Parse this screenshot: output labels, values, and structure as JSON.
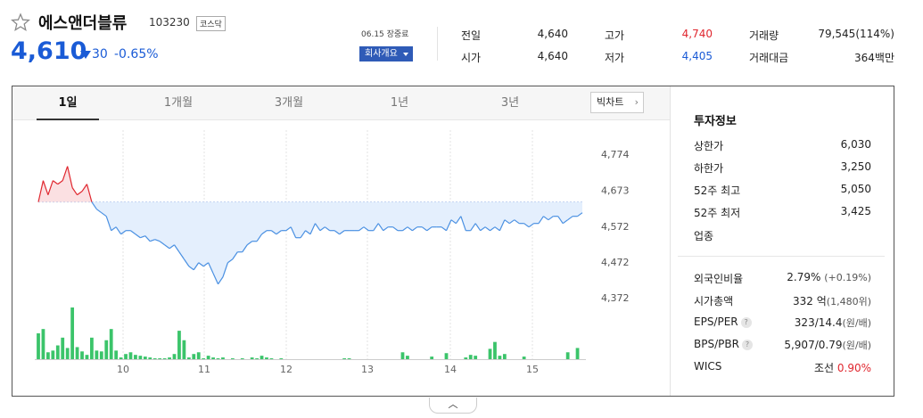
{
  "stock": {
    "name": "에스앤더블류",
    "code": "103230",
    "market_badge": "코스닥",
    "price": "4,610",
    "change": "30",
    "change_rate": "-0.65%",
    "as_of": "06.15 장중료",
    "company_button": "회사개요"
  },
  "quote": {
    "prev_close_label": "전일",
    "prev_close": "4,640",
    "open_label": "시가",
    "open": "4,640",
    "high_label": "고가",
    "high": "4,740",
    "low_label": "저가",
    "low": "4,405",
    "volume_label": "거래량",
    "volume": "79,545(114%)",
    "amount_label": "거래대금",
    "amount": "364백만"
  },
  "tabs": [
    "1일",
    "1개월",
    "3개월",
    "1년",
    "3년"
  ],
  "big_chart_button": "빅차트",
  "invest": {
    "title": "투자정보",
    "upper_label": "상한가",
    "upper": "6,030",
    "lower_label": "하한가",
    "lower": "3,250",
    "high52_label": "52주 최고",
    "high52": "5,050",
    "low52_label": "52주 최저",
    "low52": "3,425",
    "industry_label": "업종",
    "foreign_label": "외국인비율",
    "foreign": "2.79%",
    "foreign_chg": "(+0.19%)",
    "mcap_label": "시가총액",
    "mcap": "332 억",
    "mcap_sub": "(1,480위)",
    "eps_label": "EPS/PER",
    "eps": "323/14.4",
    "eps_unit": "(원/배)",
    "bps_label": "BPS/PBR",
    "bps": "5,907/0.79",
    "bps_unit": "(원/배)",
    "wics_label": "WICS",
    "wics": "조선",
    "wics_rate": "0.90%"
  },
  "chart_data": {
    "type": "line",
    "y_ticks": [
      "4,774",
      "4,673",
      "4,572",
      "4,472",
      "4,372"
    ],
    "x_ticks": [
      "10",
      "11",
      "12",
      "13",
      "14",
      "15"
    ],
    "ylim": [
      4372,
      4774
    ],
    "baseline": 4640,
    "up_color": "#e0272f",
    "down_color": "#4a90e2",
    "volume_color": "#3bc46a",
    "price": [
      4640,
      4700,
      4660,
      4700,
      4690,
      4700,
      4740,
      4680,
      4660,
      4670,
      4690,
      4640,
      4620,
      4610,
      4600,
      4560,
      4570,
      4550,
      4560,
      4560,
      4550,
      4540,
      4545,
      4530,
      4535,
      4530,
      4520,
      4510,
      4520,
      4500,
      4480,
      4460,
      4450,
      4470,
      4460,
      4470,
      4440,
      4410,
      4430,
      4470,
      4480,
      4500,
      4500,
      4520,
      4530,
      4530,
      4550,
      4560,
      4560,
      4550,
      4560,
      4560,
      4570,
      4540,
      4540,
      4560,
      4550,
      4580,
      4560,
      4570,
      4560,
      4560,
      4550,
      4560,
      4560,
      4560,
      4560,
      4570,
      4560,
      4560,
      4580,
      4560,
      4570,
      4570,
      4560,
      4560,
      4570,
      4560,
      4570,
      4570,
      4560,
      4570,
      4570,
      4570,
      4560,
      4590,
      4580,
      4600,
      4560,
      4560,
      4580,
      4560,
      4570,
      4560,
      4570,
      4560,
      4590,
      4580,
      4590,
      4580,
      4580,
      4570,
      4580,
      4580,
      4600,
      4590,
      4600,
      4600,
      4580,
      4590,
      4600,
      4600,
      4610
    ],
    "volume": [
      30,
      35,
      8,
      10,
      16,
      25,
      13,
      60,
      14,
      9,
      5,
      25,
      10,
      9,
      22,
      35,
      10,
      2,
      6,
      8,
      5,
      4,
      3,
      2,
      1,
      1,
      1,
      2,
      6,
      33,
      22,
      2,
      6,
      8,
      1,
      4,
      2,
      1,
      2,
      0,
      1,
      0,
      1,
      0,
      2,
      1,
      4,
      2,
      1,
      0,
      1,
      0,
      0,
      0,
      0,
      0,
      0,
      0,
      0,
      0,
      0,
      0,
      0,
      1,
      1,
      0,
      0,
      0,
      0,
      0,
      0,
      0,
      0,
      0,
      0,
      8,
      4,
      0,
      0,
      0,
      0,
      3,
      0,
      0,
      7,
      0,
      0,
      0,
      2,
      5,
      4,
      0,
      0,
      12,
      20,
      4,
      6,
      0,
      0,
      0,
      3,
      0,
      0,
      0,
      0,
      0,
      0,
      0,
      0,
      8,
      0,
      13
    ]
  }
}
